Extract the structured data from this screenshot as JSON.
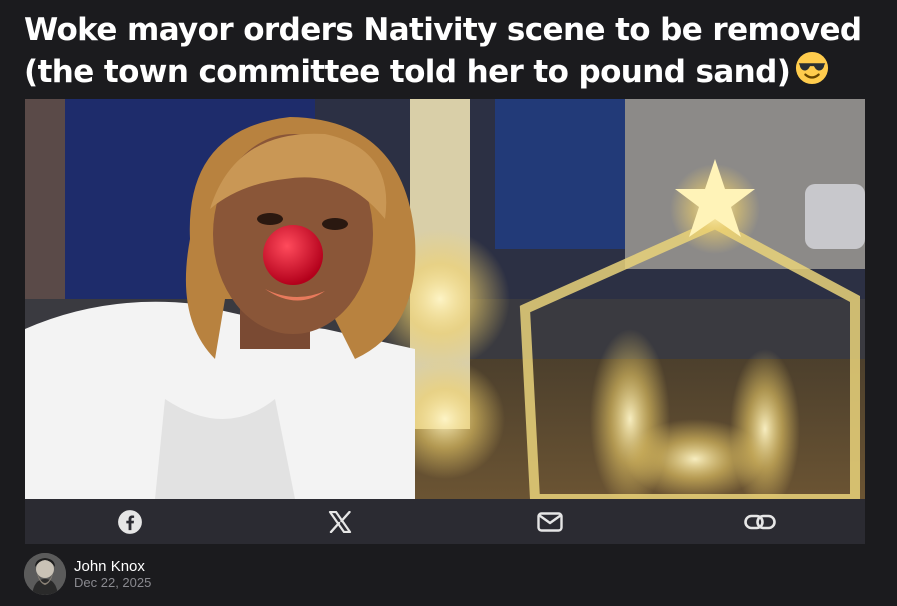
{
  "article": {
    "title_line1": "Woke mayor orders Nativity scene to be removed",
    "title_line2": "(the town committee told her to pound sand)",
    "title_emoji": "😎"
  },
  "hero_image": {
    "alt": "Woke mayor orders Nativity scene to be removed (the town committee told her to pound sand) 😎"
  },
  "share": {
    "buttons": [
      {
        "icon": "facebook-icon"
      },
      {
        "icon": "x-icon"
      },
      {
        "icon": "mail-icon"
      },
      {
        "icon": "link-icon"
      }
    ]
  },
  "author": {
    "name": "John Knox",
    "date": "Dec 22, 2025"
  },
  "colors": {
    "background": "#1b1b1e",
    "share_bar": "#2b2b32",
    "icon": "#e6e6e6",
    "muted_text": "#8a8a90"
  }
}
